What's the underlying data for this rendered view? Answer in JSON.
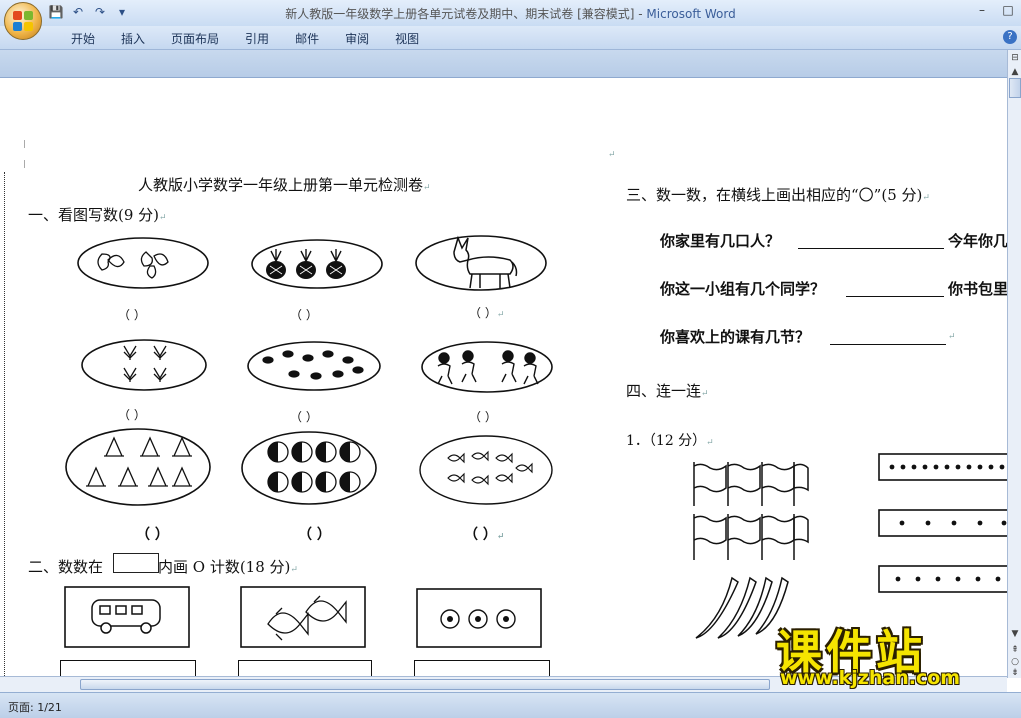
{
  "window": {
    "title_doc": "新人教版一年级数学上册各单元试卷及期中、期末试卷 [兼容模式] - ",
    "title_app": "Microsoft Word"
  },
  "ribbon": {
    "tabs": [
      "开始",
      "插入",
      "页面布局",
      "引用",
      "邮件",
      "审阅",
      "视图"
    ]
  },
  "status": {
    "page": "页面: 1/21"
  },
  "document": {
    "title": "人教版小学数学一年级上册第一单元检测卷",
    "section1": "一、看图写数(9 分)",
    "paren": "（    ）",
    "paren_short": "（ ）",
    "section2_pre": "二、数数在",
    "section2_post": "内画 O 计数(18 分)",
    "section3": "三、数一数，在横线上画出相应的“〇”(5 分)",
    "q1": "你家里有几口人？",
    "q1_right": "今年你几",
    "q2": "你这一小组有几个同学？",
    "q2_right": "你书包里",
    "q3": "你喜欢上的课有几节？",
    "section4": "四、连一连",
    "sub1": "1．（12 分）",
    "mark": "↵"
  },
  "watermark": {
    "big": "课件站",
    "url": "www.kjzhan.com"
  }
}
